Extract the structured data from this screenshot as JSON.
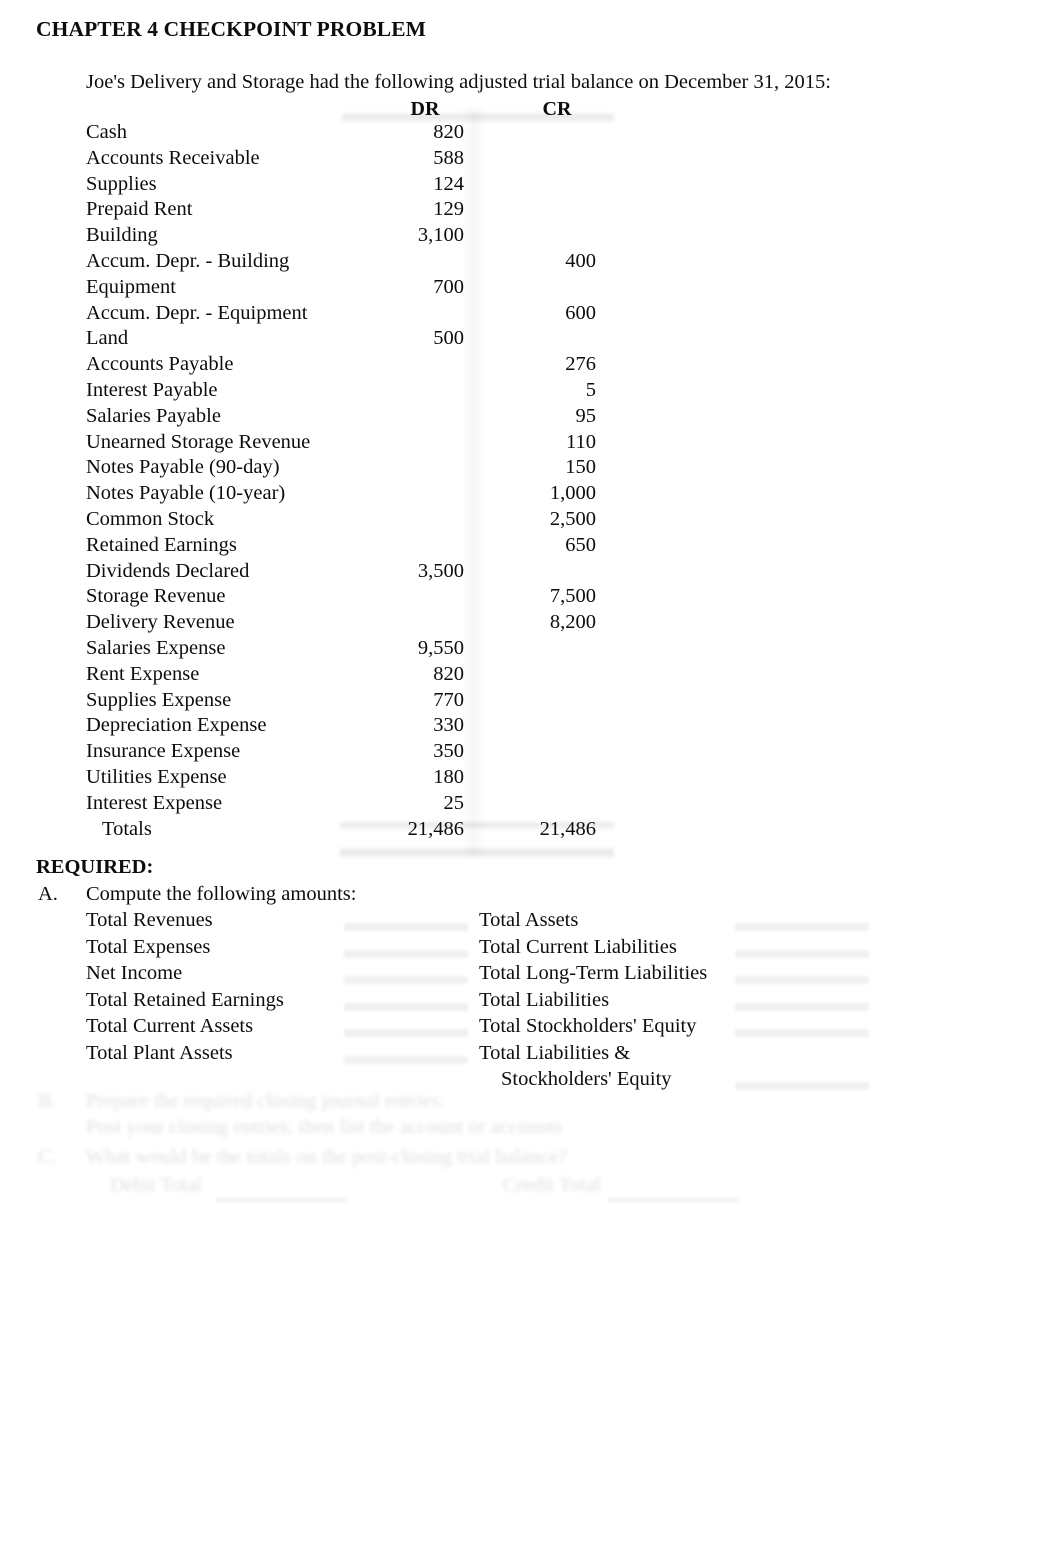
{
  "document": {
    "title": "CHAPTER 4 CHECKPOINT PROBLEM",
    "intro": "Joe's Delivery and Storage had the following adjusted trial balance on December 31, 2015:"
  },
  "trial_balance": {
    "columns": {
      "account": "",
      "dr": "DR",
      "cr": "CR"
    },
    "rows": [
      {
        "account": "Cash",
        "dr": "820",
        "cr": ""
      },
      {
        "account": "Accounts Receivable",
        "dr": "588",
        "cr": ""
      },
      {
        "account": "Supplies",
        "dr": "124",
        "cr": ""
      },
      {
        "account": "Prepaid Rent",
        "dr": "129",
        "cr": ""
      },
      {
        "account": "Building",
        "dr": "3,100",
        "cr": ""
      },
      {
        "account": "Accum. Depr. - Building",
        "dr": "",
        "cr": "400"
      },
      {
        "account": "Equipment",
        "dr": "700",
        "cr": ""
      },
      {
        "account": "Accum. Depr. - Equipment",
        "dr": "",
        "cr": "600"
      },
      {
        "account": "Land",
        "dr": "500",
        "cr": ""
      },
      {
        "account": "Accounts Payable",
        "dr": "",
        "cr": "276"
      },
      {
        "account": "Interest Payable",
        "dr": "",
        "cr": "5"
      },
      {
        "account": "Salaries Payable",
        "dr": "",
        "cr": "95"
      },
      {
        "account": "Unearned Storage Revenue",
        "dr": "",
        "cr": "110"
      },
      {
        "account": "Notes Payable (90-day)",
        "dr": "",
        "cr": "150"
      },
      {
        "account": "Notes Payable (10-year)",
        "dr": "",
        "cr": "1,000"
      },
      {
        "account": "Common Stock",
        "dr": "",
        "cr": "2,500"
      },
      {
        "account": "Retained Earnings",
        "dr": "",
        "cr": "650"
      },
      {
        "account": "Dividends Declared",
        "dr": "3,500",
        "cr": ""
      },
      {
        "account": "Storage Revenue",
        "dr": "",
        "cr": "7,500"
      },
      {
        "account": "Delivery Revenue",
        "dr": "",
        "cr": "8,200"
      },
      {
        "account": "Salaries Expense",
        "dr": "9,550",
        "cr": ""
      },
      {
        "account": "Rent Expense",
        "dr": "820",
        "cr": ""
      },
      {
        "account": "Supplies Expense",
        "dr": "770",
        "cr": ""
      },
      {
        "account": "Depreciation Expense",
        "dr": "330",
        "cr": ""
      },
      {
        "account": "Insurance Expense",
        "dr": "350",
        "cr": ""
      },
      {
        "account": "Utilities Expense",
        "dr": "180",
        "cr": ""
      },
      {
        "account": "Interest Expense",
        "dr": "25",
        "cr": ""
      },
      {
        "account": "Totals",
        "dr": "21,486",
        "cr": "21,486"
      }
    ]
  },
  "required": {
    "heading": "REQUIRED:",
    "item_a": {
      "letter": "A.",
      "text": "Compute the following amounts:"
    },
    "left_items": [
      "Total Revenues",
      "Total Expenses",
      "Net Income",
      "Total Retained Earnings",
      "Total Current Assets",
      "Total Plant Assets"
    ],
    "right_items": [
      "Total Assets",
      "Total Current Liabilities",
      "Total Long-Term Liabilities",
      "Total Liabilities",
      "Total Stockholders' Equity",
      "Total Liabilities &",
      "Stockholders' Equity"
    ]
  },
  "faded_section": {
    "items": [
      {
        "letter": "B.",
        "text": "Prepare the required closing journal entries."
      },
      {
        "letter": "",
        "text": "Post your closing entries; then list the account or accounts"
      },
      {
        "letter": "C.",
        "text": "What would be the totals on the post-closing trial balance?"
      }
    ],
    "debit_label": "Debit Total",
    "credit_label": "Credit Total"
  }
}
